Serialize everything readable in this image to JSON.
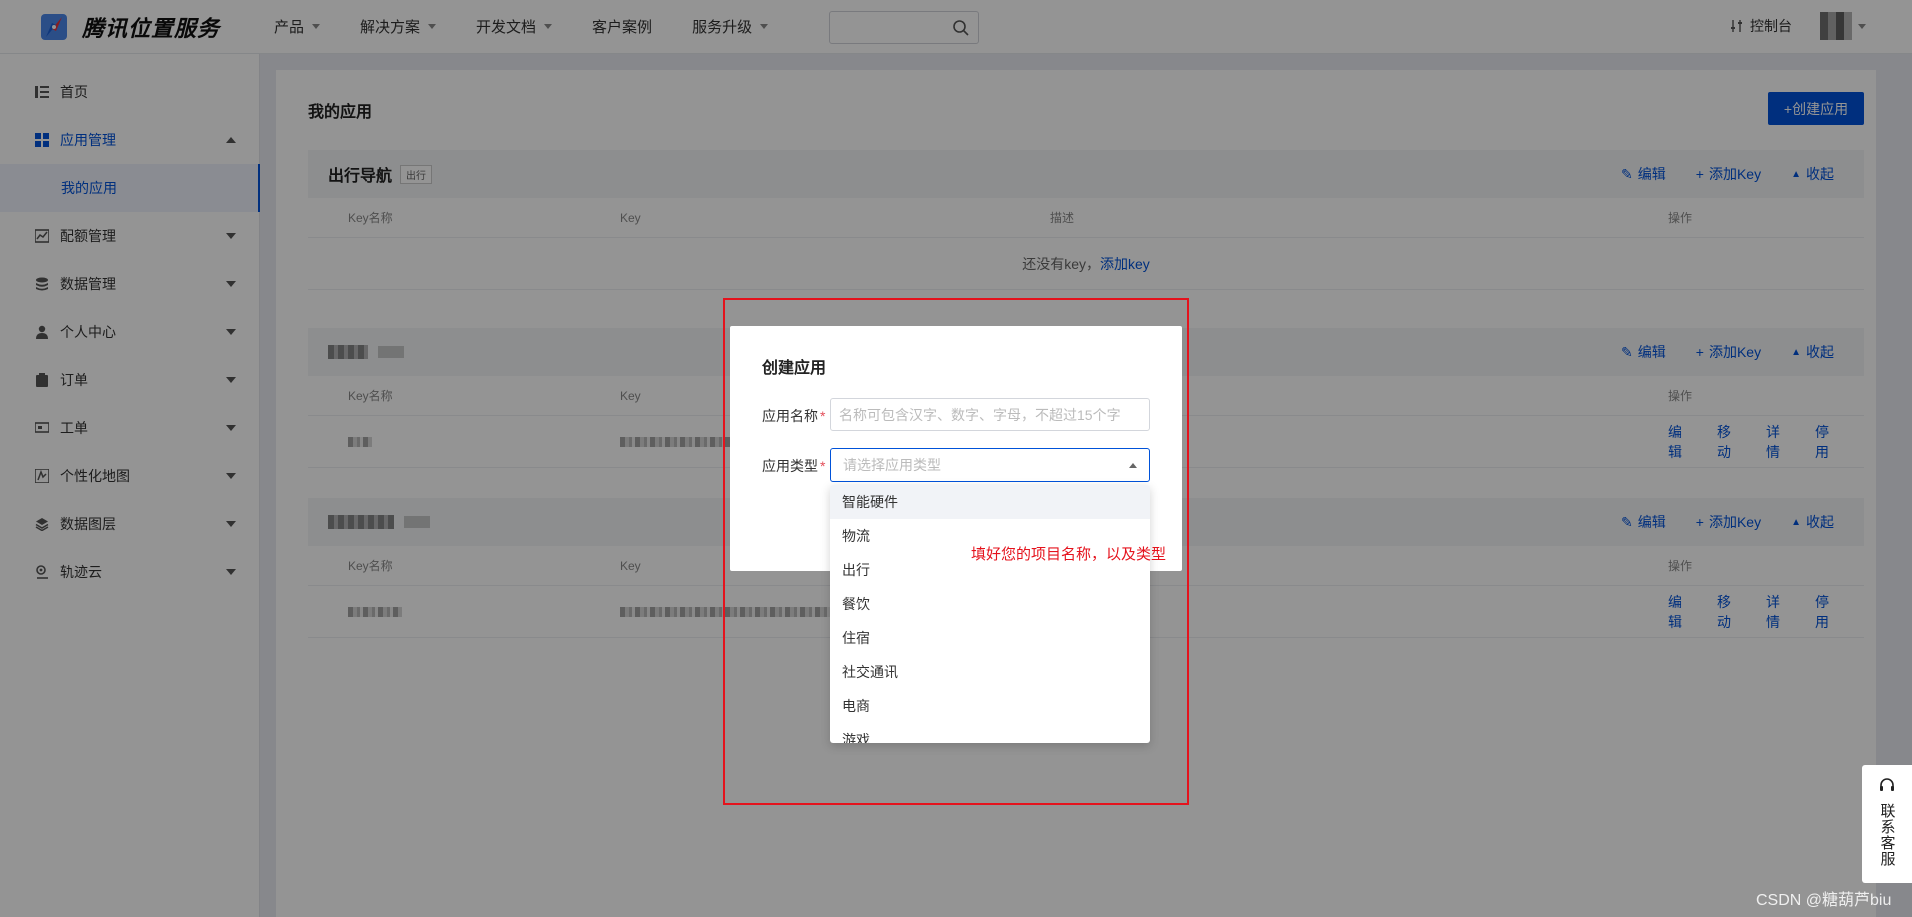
{
  "header": {
    "logo_text": "腾讯位置服务",
    "nav": [
      {
        "label": "产品",
        "dropdown": true
      },
      {
        "label": "解决方案",
        "dropdown": true
      },
      {
        "label": "开发文档",
        "dropdown": true
      },
      {
        "label": "客户案例",
        "dropdown": false
      },
      {
        "label": "服务升级",
        "dropdown": true
      }
    ],
    "search_placeholder": "",
    "console_label": "控制台"
  },
  "sidebar": {
    "items": [
      {
        "label": "首页",
        "icon": "list-icon"
      },
      {
        "label": "应用管理",
        "icon": "grid-icon",
        "expanded": true
      },
      {
        "label": "配额管理",
        "icon": "chart-icon"
      },
      {
        "label": "数据管理",
        "icon": "database-icon"
      },
      {
        "label": "个人中心",
        "icon": "user-icon"
      },
      {
        "label": "订单",
        "icon": "clipboard-icon"
      },
      {
        "label": "工单",
        "icon": "ticket-icon"
      },
      {
        "label": "个性化地图",
        "icon": "map-style-icon"
      },
      {
        "label": "数据图层",
        "icon": "layers-icon"
      },
      {
        "label": "轨迹云",
        "icon": "track-icon"
      }
    ],
    "sub_item": "我的应用"
  },
  "main": {
    "title": "我的应用",
    "create_button": "+创建应用",
    "actions": {
      "edit": "编辑",
      "add_key": "添加Key",
      "collapse": "收起"
    },
    "columns": [
      "Key名称",
      "Key",
      "描述",
      "操作"
    ],
    "row_actions": [
      "编辑",
      "移动",
      "详情",
      "停用"
    ],
    "apps": [
      {
        "name": "出行导航",
        "tag": "出行",
        "empty_text": "还没有key，",
        "empty_link": "添加key"
      }
    ]
  },
  "modal": {
    "title": "创建应用",
    "name_label": "应用名称",
    "name_placeholder": "名称可包含汉字、数字、字母，不超过15个字",
    "type_label": "应用类型",
    "type_placeholder": "请选择应用类型",
    "required_mark": "*",
    "type_options": [
      "智能硬件",
      "物流",
      "出行",
      "餐饮",
      "住宿",
      "社交通讯",
      "电商",
      "游戏"
    ]
  },
  "annotation": {
    "text": "填好您的项目名称，以及类型",
    "color": "#e5131d"
  },
  "service": {
    "label": "联系客服"
  },
  "watermark": "CSDN @糖葫芦biu",
  "colors": {
    "primary": "#0052d9",
    "required": "#e34d59"
  }
}
